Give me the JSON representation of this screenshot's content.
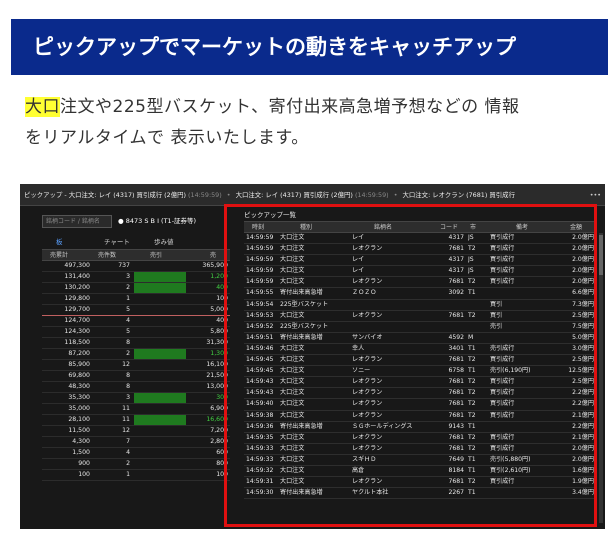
{
  "banner": {
    "title": "ピックアップでマーケットの動きをキャッチアップ"
  },
  "description": {
    "highlight": "大口",
    "line1_rest": "注文や225型バスケット、寄付出来高急増予想などの 情報",
    "line2": "をリアルタイムで 表示いたします。"
  },
  "screenshot": {
    "title_items": [
      "ピックアップ - 大口注文: レイ (4317) 買引成行 (2億円)",
      "大口注文: レイ (4317) 買引成行 (2億円)",
      "大口注文: レオクラン (7681) 買引成行"
    ],
    "title_times": [
      "(14:59:59)",
      "(14:59:59)"
    ],
    "menu_label": "•••",
    "left": {
      "code_placeholder": "銘柄コード / 銘柄名",
      "stock": "● 8473 S B I (T1-証券等)",
      "tabs": [
        "板",
        "チャート",
        "歩み値"
      ],
      "headers": [
        "売累計",
        "売件数",
        "売引",
        "売"
      ],
      "rows": [
        [
          "497,300",
          "737",
          "",
          "365,900"
        ],
        [
          "131,400",
          "3",
          "g",
          "1,200"
        ],
        [
          "130,200",
          "2",
          "g",
          "400"
        ],
        [
          "129,800",
          "1",
          "",
          "100"
        ],
        [
          "129,700",
          "5",
          "",
          "5,000"
        ],
        [
          "124,700",
          "4",
          "",
          "400"
        ],
        [
          "124,300",
          "5",
          "",
          "5,800"
        ],
        [
          "118,500",
          "8",
          "",
          "31,300"
        ],
        [
          "87,200",
          "2",
          "g",
          "1,300"
        ],
        [
          "85,900",
          "12",
          "",
          "16,100"
        ],
        [
          "69,800",
          "8",
          "",
          "21,500"
        ],
        [
          "48,300",
          "8",
          "",
          "13,000"
        ],
        [
          "35,300",
          "3",
          "g",
          "300"
        ],
        [
          "35,000",
          "11",
          "",
          "6,900"
        ],
        [
          "28,100",
          "11",
          "g",
          "16,600"
        ],
        [
          "11,500",
          "12",
          "",
          "7,200"
        ],
        [
          "4,300",
          "7",
          "",
          "2,800"
        ],
        [
          "1,500",
          "4",
          "",
          "600"
        ],
        [
          "900",
          "2",
          "",
          "800"
        ],
        [
          "100",
          "1",
          "",
          "100"
        ]
      ]
    },
    "pickup": {
      "title": "ピックアップ一覧",
      "headers": [
        "時刻",
        "種別",
        "銘柄名",
        "コード",
        "市",
        "備考",
        "金額"
      ],
      "rows": [
        [
          "14:59:59",
          "大口注文",
          "レイ",
          "4317",
          "JS",
          "買引成行",
          "2.0億円"
        ],
        [
          "14:59:59",
          "大口注文",
          "レオクラン",
          "7681",
          "T2",
          "買引成行",
          "2.0億円"
        ],
        [
          "14:59:59",
          "大口注文",
          "レイ",
          "4317",
          "JS",
          "買引成行",
          "2.0億円"
        ],
        [
          "14:59:59",
          "大口注文",
          "レイ",
          "4317",
          "JS",
          "買引成行",
          "2.0億円"
        ],
        [
          "14:59:59",
          "大口注文",
          "レオクラン",
          "7681",
          "T2",
          "買引成行",
          "2.0億円"
        ],
        [
          "14:59:55",
          "寄付出来高急増",
          "ＺＯＺＯ",
          "3092",
          "T1",
          "",
          "6.6億円"
        ],
        [
          "14:59:54",
          "225型バスケット",
          "",
          "",
          "",
          "買引",
          "7.3億円"
        ],
        [
          "14:59:53",
          "大口注文",
          "レオクラン",
          "7681",
          "T2",
          "買引",
          "2.5億円"
        ],
        [
          "14:59:52",
          "225型バスケット",
          "",
          "",
          "",
          "売引",
          "7.5億円"
        ],
        [
          "14:59:51",
          "寄付出来高急増",
          "サンバイオ",
          "4592",
          "M",
          "",
          "5.0億円"
        ],
        [
          "14:59:46",
          "大口注文",
          "幸人",
          "3401",
          "T1",
          "売引成行",
          "3.0億円"
        ],
        [
          "14:59:45",
          "大口注文",
          "レオクラン",
          "7681",
          "T2",
          "買引成行",
          "2.5億円"
        ],
        [
          "14:59:45",
          "大口注文",
          "ソニー",
          "6758",
          "T1",
          "売引(6,190円)",
          "12.5億円"
        ],
        [
          "14:59:43",
          "大口注文",
          "レオクラン",
          "7681",
          "T2",
          "買引成行",
          "2.5億円"
        ],
        [
          "14:59:43",
          "大口注文",
          "レオクラン",
          "7681",
          "T2",
          "買引成行",
          "2.2億円"
        ],
        [
          "14:59:40",
          "大口注文",
          "レオクラン",
          "7681",
          "T2",
          "買引成行",
          "2.2億円"
        ],
        [
          "14:59:38",
          "大口注文",
          "レオクラン",
          "7681",
          "T2",
          "買引成行",
          "2.1億円"
        ],
        [
          "14:59:36",
          "寄付出来高急増",
          "ＳＧホールディングス",
          "9143",
          "T1",
          "",
          "2.2億円"
        ],
        [
          "14:59:35",
          "大口注文",
          "レオクラン",
          "7681",
          "T2",
          "買引成行",
          "2.1億円"
        ],
        [
          "14:59:33",
          "大口注文",
          "レオクラン",
          "7681",
          "T2",
          "買引成行",
          "2.0億円"
        ],
        [
          "14:59:33",
          "大口注文",
          "スギＨＤ",
          "7649",
          "T1",
          "売引(5,880円)",
          "2.0億円"
        ],
        [
          "14:59:32",
          "大口注文",
          "高倉",
          "8184",
          "T1",
          "買引(2,610円)",
          "1.6億円"
        ],
        [
          "14:59:31",
          "大口注文",
          "レオクラン",
          "7681",
          "T2",
          "買引成行",
          "1.9億円"
        ],
        [
          "14:59:30",
          "寄付出来高急増",
          "ヤクルト本社",
          "2267",
          "T1",
          "",
          "3.4億円"
        ]
      ]
    }
  },
  "colors": {
    "banner": "#0a2a8c",
    "highlight": "#ffff33",
    "frame": "#e01010"
  }
}
